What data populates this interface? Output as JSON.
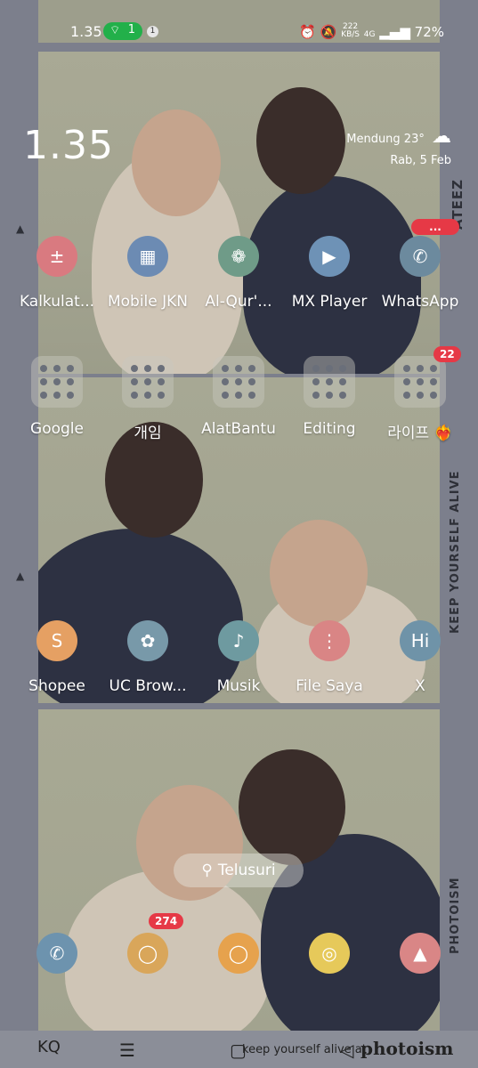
{
  "status_bar": {
    "time": "1.35",
    "wifi_count": "1",
    "notif_count": "1",
    "net_speed": "222",
    "net_unit": "KB/S",
    "net_type": "4G",
    "battery": "72%"
  },
  "clock_widget": {
    "time": "1.35",
    "weather": "Mendung 23°",
    "date": "Rab, 5 Feb"
  },
  "row1": [
    {
      "label": "Kalkulat...",
      "color": "#d97a80",
      "icon": "calculator-icon",
      "glyph": "±"
    },
    {
      "label": "Mobile JKN",
      "color": "#6c8bb3",
      "icon": "jkn-icon",
      "glyph": "▦"
    },
    {
      "label": "Al-Qur'...",
      "color": "#6f9b88",
      "icon": "quran-icon",
      "glyph": "❁"
    },
    {
      "label": "MX Player",
      "color": "#6e92b6",
      "icon": "play-icon",
      "glyph": "▶"
    },
    {
      "label": "WhatsApp",
      "color": "#6c8a9e",
      "icon": "whatsapp-icon",
      "glyph": "✆"
    }
  ],
  "row1_badge": "...",
  "row2": [
    {
      "label": "Google"
    },
    {
      "label": "개임"
    },
    {
      "label": "AlatBantu"
    },
    {
      "label": "Editing"
    },
    {
      "label": "라이프 ❤️‍🔥"
    }
  ],
  "row2_badge": "22",
  "row3": [
    {
      "label": "Shopee",
      "color": "#e5a063",
      "icon": "shopee-icon",
      "glyph": "S"
    },
    {
      "label": "UC Brow...",
      "color": "#7899a9",
      "icon": "uc-browser-icon",
      "glyph": "✿"
    },
    {
      "label": "Musik",
      "color": "#6e9aa0",
      "icon": "music-icon",
      "glyph": "♪"
    },
    {
      "label": "File Saya",
      "color": "#d98585",
      "icon": "folder-icon",
      "glyph": "⋮"
    },
    {
      "label": "X",
      "color": "#6f93a8",
      "icon": "x-hi-icon",
      "glyph": "Hi"
    }
  ],
  "search": {
    "label": "Telusuri"
  },
  "dock": [
    {
      "color": "#6d93ae",
      "icon": "phone-icon",
      "glyph": "✆"
    },
    {
      "color": "#d9a65a",
      "icon": "message-icon",
      "glyph": "◯"
    },
    {
      "color": "#e6a24d",
      "icon": "chat-icon",
      "glyph": "◯"
    },
    {
      "color": "#e6c95a",
      "icon": "camera-icon",
      "glyph": "◎"
    },
    {
      "color": "#d98686",
      "icon": "gallery-icon",
      "glyph": "▲"
    }
  ],
  "dock_badge": "274",
  "side_texts": {
    "keep_alive": "KEEP YOURSELF ALIVE",
    "photoism": "PHOTOISM",
    "ateez": "ATEEZ"
  },
  "footer": {
    "keep_alive": "keep yourself alive at",
    "brand": "photoism"
  }
}
